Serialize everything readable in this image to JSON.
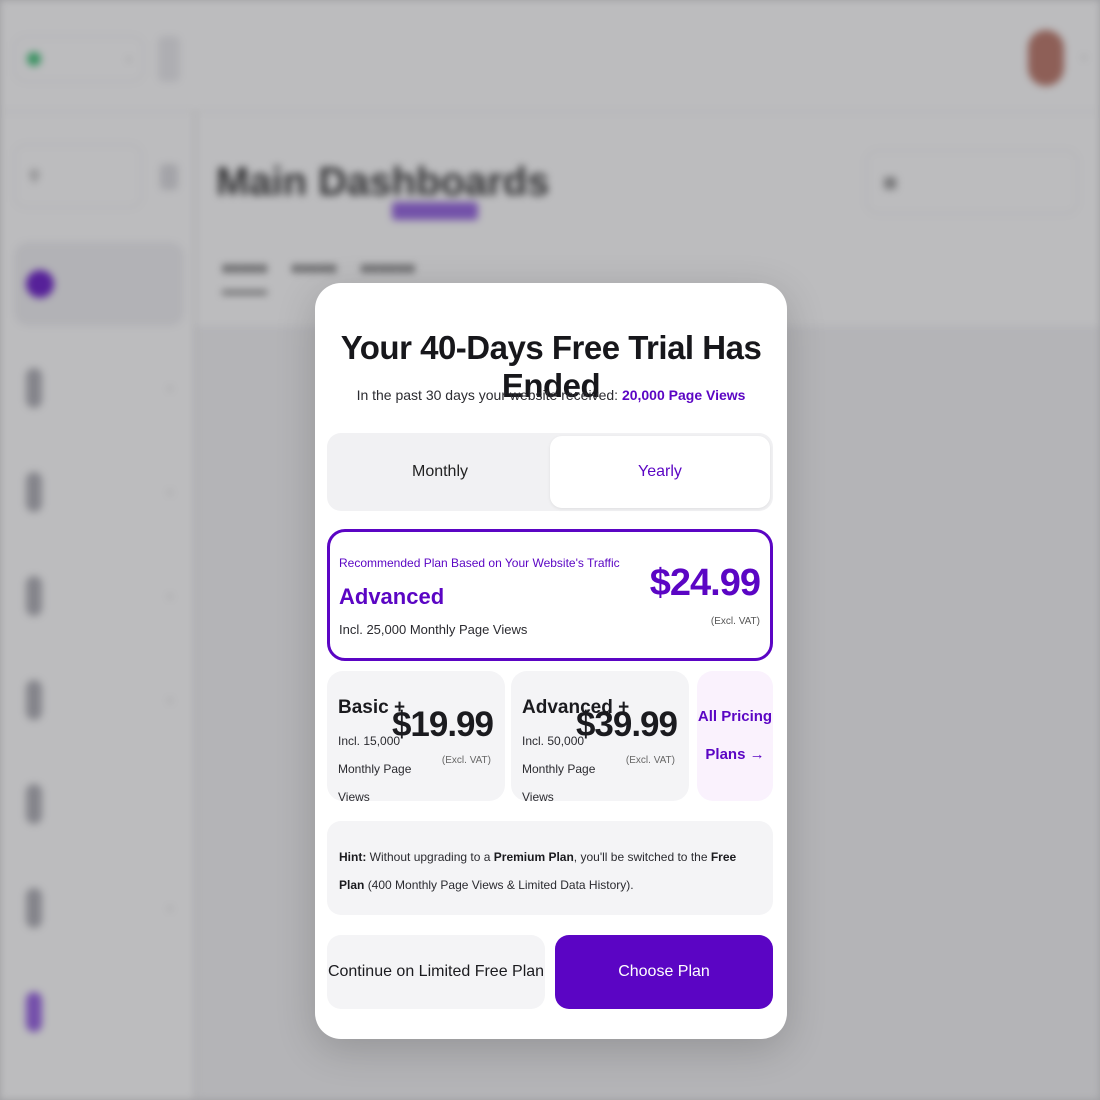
{
  "colors": {
    "brand": "#5b05c4",
    "card_bg": "#f4f4f6",
    "all_plans_bg": "#faf2fd",
    "overlay": "rgba(80,80,84,0.38)"
  },
  "modal": {
    "title": "Your 40-Days Free Trial Has Ended",
    "subtitle_prefix": "In the past 30 days your website received:",
    "subtitle_highlight": "20,000 Page Views",
    "billing_toggle": {
      "options": [
        "Monthly",
        "Yearly"
      ],
      "selected": "Yearly"
    },
    "recommended_plan": {
      "tag": "Recommended Plan Based on Your Website's Traffic",
      "name": "Advanced",
      "included": "Incl. 25,000 Monthly Page Views",
      "price": "$24.99",
      "vat_note": "(Excl. VAT)"
    },
    "plans": [
      {
        "name": "Basic +",
        "included": "Incl. 15,000 Monthly Page Views",
        "price": "$19.99",
        "vat_note": "(Excl. VAT)"
      },
      {
        "name": "Advanced +",
        "included": "Incl. 50,000 Monthly Page Views",
        "price": "$39.99",
        "vat_note": "(Excl. VAT)"
      }
    ],
    "all_plans_link": "All Pricing Plans →",
    "hint": {
      "label": "Hint:",
      "text_1": "Without upgrading to a",
      "bold_1": "Premium Plan",
      "text_2": ", you'll be switched to the",
      "bold_2": "Free Plan",
      "text_3": "(400 Monthly Page Views & Limited Data History)."
    },
    "buttons": {
      "continue_free": "Continue on Limited Free Plan",
      "choose_plan": "Choose Plan"
    }
  },
  "background": {
    "site_selector_icon": "chevron-down-icon",
    "main_title": "Main Dashboards",
    "icons": [
      "search-icon",
      "calendar-icon",
      "avatar"
    ]
  }
}
